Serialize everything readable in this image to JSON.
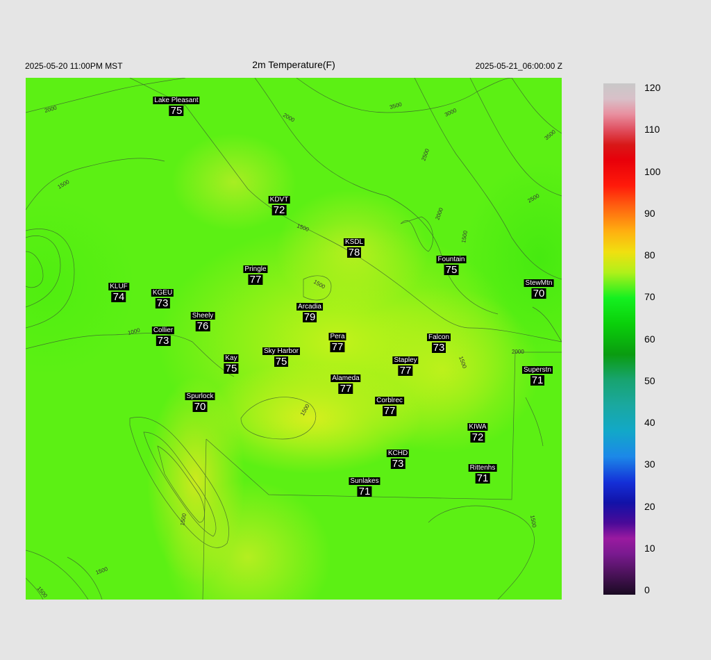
{
  "header": {
    "valid_local": "2025-05-20 11:00PM MST",
    "title": "2m Temperature(F)",
    "valid_utc": "2025-05-21_06:00:00 Z"
  },
  "stations": [
    {
      "name": "Lake Pleasant",
      "temp": "75"
    },
    {
      "name": "KDVT",
      "temp": "72"
    },
    {
      "name": "KSDL",
      "temp": "78"
    },
    {
      "name": "Fountain",
      "temp": "75"
    },
    {
      "name": "StewMtn",
      "temp": "70"
    },
    {
      "name": "Pringle",
      "temp": "77"
    },
    {
      "name": "KLUF",
      "temp": "74"
    },
    {
      "name": "KGEU",
      "temp": "73"
    },
    {
      "name": "Arcadia",
      "temp": "79"
    },
    {
      "name": "Sheely",
      "temp": "76"
    },
    {
      "name": "Collier",
      "temp": "73"
    },
    {
      "name": "Pera",
      "temp": "77"
    },
    {
      "name": "Falcon",
      "temp": "73"
    },
    {
      "name": "Kay",
      "temp": "75"
    },
    {
      "name": "Sky Harbor",
      "temp": "75"
    },
    {
      "name": "Stapley",
      "temp": "77"
    },
    {
      "name": "Superstn",
      "temp": "71"
    },
    {
      "name": "Alameda",
      "temp": "77"
    },
    {
      "name": "Spurlock",
      "temp": "70"
    },
    {
      "name": "Corblrec",
      "temp": "77"
    },
    {
      "name": "KIWA",
      "temp": "72"
    },
    {
      "name": "KCHD",
      "temp": "73"
    },
    {
      "name": "Rittenhs",
      "temp": "71"
    },
    {
      "name": "Sunlakes",
      "temp": "71"
    }
  ],
  "contour_labels": [
    "2000",
    "3500",
    "3000",
    "2000",
    "3500",
    "2500",
    "1500",
    "2500",
    "2000",
    "1500",
    "1500",
    "1500",
    "1000",
    "1500",
    "2000",
    "1500",
    "1500",
    "1500",
    "1500",
    "1500"
  ],
  "colorbar": {
    "ticks": [
      "120",
      "110",
      "100",
      "90",
      "80",
      "70",
      "60",
      "50",
      "40",
      "30",
      "20",
      "10",
      "0"
    ]
  }
}
